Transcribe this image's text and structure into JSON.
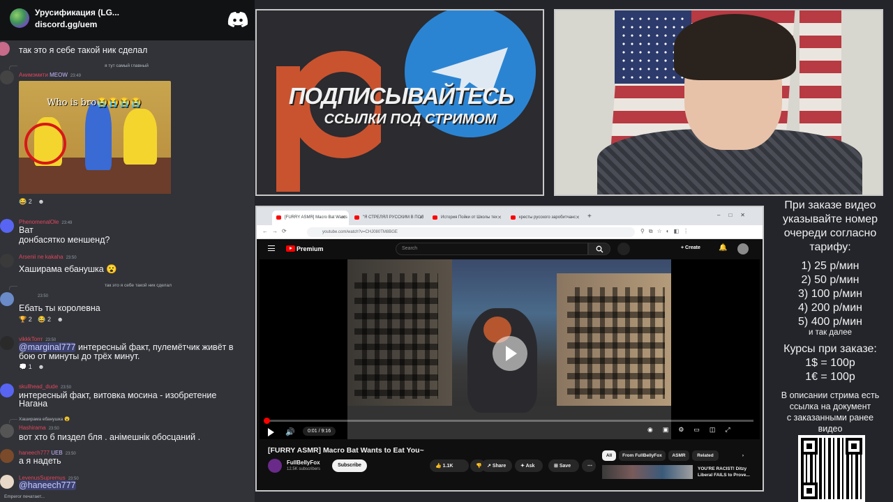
{
  "discord": {
    "server_name": "Урусификация (LG...",
    "invite": "discord.gg/uem",
    "messages": [
      {
        "body": "так это я себе такой ник сделал"
      },
      {
        "reply": "я тут самый главный",
        "username": "Анимэмити",
        "badge": "MEOW",
        "time": "23:49",
        "image_caption": "Who is bro😭😭😭😭",
        "reactions": [
          "😂 2",
          "☻"
        ]
      },
      {
        "username": "PhenomenalOle",
        "time": "23:49",
        "body1": "Ват",
        "body2": "донбасятко меншенд?"
      },
      {
        "username": "Arsenii ne kakaha",
        "time": "23:50",
        "body": "Хаширама ебанушка 😮"
      },
      {
        "reply": "так это я себе такой ник сделал",
        "time": "23:50",
        "body": "Ебать ты королевна",
        "reactions": [
          "🏆 2",
          "😂 2",
          "☻"
        ]
      },
      {
        "username": "vikkkTorrr",
        "time": "23:50",
        "mention": "@marginal777",
        "body1": "интересный факт, пулемётчик живёт в",
        "body2": "бою от минуты до трёх минут.",
        "reactions": [
          "💭 1",
          "☻"
        ]
      },
      {
        "username": "skullhead_dude",
        "time": "23:50",
        "body1": "интересный факт, витовка мосина - изобретение",
        "body2": "Нагана"
      },
      {
        "reply": "Хаширама ебанушка 😮",
        "username": "Hashirama",
        "time": "23:50",
        "body": "вот  хто б пиздел бля . анімешнік обосцаний  ."
      },
      {
        "username": "haneech777",
        "badge": "UEB",
        "time": "23:50",
        "body": "а я надеть"
      },
      {
        "username": "LevenusSupremus",
        "time": "23:50",
        "mention": "@haneech777"
      }
    ],
    "typing": "Emperor печатает..."
  },
  "promo": {
    "title": "ПОДПИСЫВАЙТЕСЬ",
    "subtitle": "ССЫЛКИ ПОД СТРИМОМ"
  },
  "browser": {
    "tabs": [
      "[FURRY ASMR] Macro Bat Wants",
      "\"Я СТРЕЛЯЛ РУССКИМ В ПОЛ",
      "История Пойки от Школы тех",
      "кресты русского заробитчанс"
    ],
    "url": "youtube.com/watch?v=CHJ080TM8BGE",
    "search_placeholder": "Search",
    "brand": "Premium",
    "create_label": "Create",
    "player": {
      "time": "0:01 / 9:16",
      "progress": 0.002
    },
    "video": {
      "title": "[FURRY ASMR] Macro Bat Wants to Eat You~",
      "channel": "FullBellyFox",
      "subscribers": "12.5K subscribers",
      "subscribe_label": "Subscribe",
      "likes": "1.1K",
      "share_label": "Share",
      "ask_label": "Ask",
      "save_label": "Save"
    },
    "chips": [
      "All",
      "From FullBellyFox",
      "ASMR",
      "Related"
    ],
    "recommended_title": "YOU'RE RACIST! Ditzy Liberal FAILS to Prove..."
  },
  "info": {
    "line1": "При заказе видео",
    "line2": "указывайте номер",
    "line3": "очереди согласно",
    "line4": "тарифу:",
    "prices": [
      "1) 25 р/мин",
      "2) 50 р/мин",
      "3) 100 р/мин",
      "4) 200 р/мин",
      "5) 400 р/мин"
    ],
    "etc": "и так далее",
    "rates_title": "Курсы при заказе:",
    "rate1": "1$ = 100р",
    "rate2": "1€ = 100р",
    "desc1": "В описании стрима есть",
    "desc2": "ссылка на документ",
    "desc3": "с заказанными ранее",
    "desc4": "видео"
  }
}
